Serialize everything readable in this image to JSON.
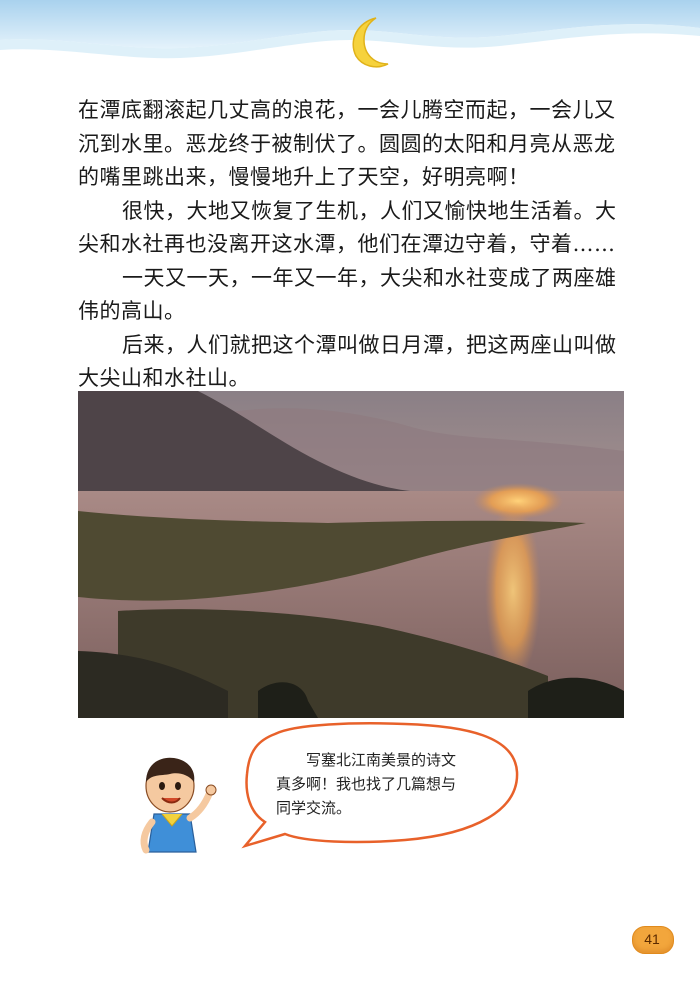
{
  "body": {
    "para1": "在潭底翻滚起几丈高的浪花，一会儿腾空而起，一会儿又沉到水里。恶龙终于被制伏了。圆圆的太阳和月亮从恶龙的嘴里跳出来，慢慢地升上了天空，好明亮啊！",
    "para2": "很快，大地又恢复了生机，人们又愉快地生活着。大尖和水社再也没离开这水潭，他们在潭边守着，守着……",
    "para3": "一天又一天，一年又一年，大尖和水社变成了两座雄伟的高山。",
    "para4": "后来，人们就把这个潭叫做日月潭，把这两座山叫做大尖山和水社山。"
  },
  "bubble": {
    "line1": "写塞北江南美景的诗文",
    "line2": "真多啊！我也找了几篇想与",
    "line3": "同学交流。"
  },
  "page_number": "41",
  "colors": {
    "sky_wave": "#cfe6f5",
    "moon": "#f6d23c",
    "page_badge": "#f2a63c",
    "bubble_border": "#e8612a"
  },
  "icons": {
    "moon": "crescent-moon-icon",
    "kid": "boy-pointing-illustration"
  }
}
